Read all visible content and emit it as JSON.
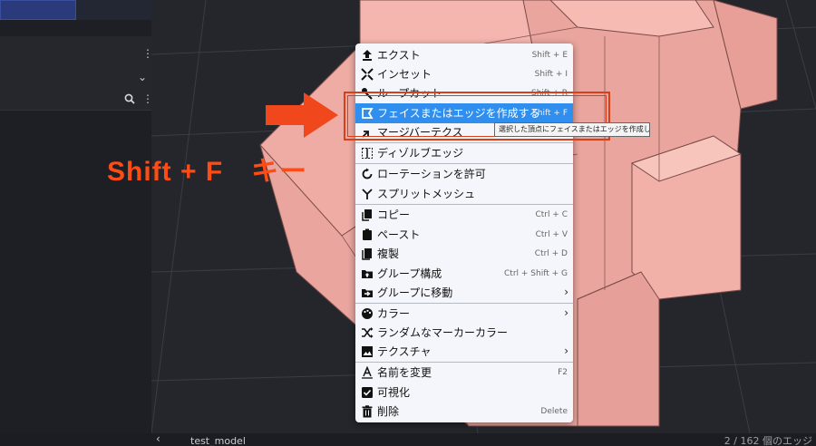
{
  "left_panel": {
    "icons": [
      "more-vertical-icon",
      "chevron-down-icon",
      "search-icon",
      "more-vertical-icon"
    ]
  },
  "viewport": {
    "model_name": "test_model",
    "selection_count": "2 / 162 個のエッジ",
    "back_glyph": "‹"
  },
  "annotation": {
    "shortcut_text": "Shift + F　キー",
    "color": "#ff4b14"
  },
  "context_menu": {
    "highlight_color": "#2f8eee",
    "items": [
      {
        "icon": "extrude-icon",
        "label": "エクスト",
        "shortcut": "Shift + E"
      },
      {
        "icon": "inset-icon",
        "label": "インセット",
        "shortcut": "Shift + I"
      },
      {
        "icon": "loop-cut-icon",
        "label": "ループカット",
        "shortcut": "Shift + R"
      },
      {
        "icon": "create-face-icon",
        "label": "フェイスまたはエッジを作成する",
        "shortcut": "Shift + F",
        "highlighted": true
      },
      {
        "icon": "merge-vertex-icon",
        "label": "マージバーテクス",
        "shortcut": ""
      },
      {
        "icon": "dissolve-edge-icon",
        "label": "ディゾルブエッジ",
        "shortcut": ""
      },
      {
        "icon": "rotation-icon",
        "label": "ローテーションを許可",
        "shortcut": ""
      },
      {
        "icon": "split-mesh-icon",
        "label": "スプリットメッシュ",
        "shortcut": ""
      },
      {
        "icon": "copy-icon",
        "label": "コピー",
        "shortcut": "Ctrl + C"
      },
      {
        "icon": "paste-icon",
        "label": "ペースト",
        "shortcut": "Ctrl + V"
      },
      {
        "icon": "duplicate-icon",
        "label": "複製",
        "shortcut": "Ctrl + D"
      },
      {
        "icon": "group-create-icon",
        "label": "グループ構成",
        "shortcut": "Ctrl + Shift + G"
      },
      {
        "icon": "group-move-icon",
        "label": "グループに移動",
        "shortcut": "",
        "submenu": true
      },
      {
        "icon": "palette-icon",
        "label": "カラー",
        "shortcut": "",
        "submenu": true
      },
      {
        "icon": "shuffle-icon",
        "label": "ランダムなマーカーカラー",
        "shortcut": ""
      },
      {
        "icon": "texture-icon",
        "label": "テクスチャ",
        "shortcut": "",
        "submenu": true
      },
      {
        "icon": "rename-icon",
        "label": "名前を変更",
        "shortcut": "F2"
      },
      {
        "icon": "checkbox-checked-icon",
        "label": "可視化",
        "shortcut": ""
      },
      {
        "icon": "trash-icon",
        "label": "削除",
        "shortcut": "Delete"
      }
    ],
    "submenu_glyph": "›",
    "tooltip": "選択した頂点にフェイスまたはエッジを作成します"
  }
}
